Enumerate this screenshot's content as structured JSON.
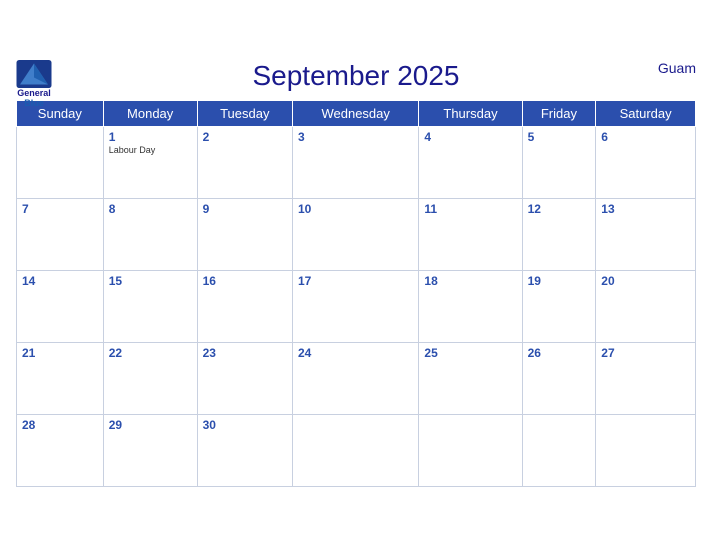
{
  "header": {
    "logo": {
      "general": "General",
      "blue": "Blue"
    },
    "title": "September 2025",
    "region": "Guam"
  },
  "days_of_week": [
    "Sunday",
    "Monday",
    "Tuesday",
    "Wednesday",
    "Thursday",
    "Friday",
    "Saturday"
  ],
  "weeks": [
    [
      {
        "date": "",
        "holiday": ""
      },
      {
        "date": "1",
        "holiday": "Labour Day"
      },
      {
        "date": "2",
        "holiday": ""
      },
      {
        "date": "3",
        "holiday": ""
      },
      {
        "date": "4",
        "holiday": ""
      },
      {
        "date": "5",
        "holiday": ""
      },
      {
        "date": "6",
        "holiday": ""
      }
    ],
    [
      {
        "date": "7",
        "holiday": ""
      },
      {
        "date": "8",
        "holiday": ""
      },
      {
        "date": "9",
        "holiday": ""
      },
      {
        "date": "10",
        "holiday": ""
      },
      {
        "date": "11",
        "holiday": ""
      },
      {
        "date": "12",
        "holiday": ""
      },
      {
        "date": "13",
        "holiday": ""
      }
    ],
    [
      {
        "date": "14",
        "holiday": ""
      },
      {
        "date": "15",
        "holiday": ""
      },
      {
        "date": "16",
        "holiday": ""
      },
      {
        "date": "17",
        "holiday": ""
      },
      {
        "date": "18",
        "holiday": ""
      },
      {
        "date": "19",
        "holiday": ""
      },
      {
        "date": "20",
        "holiday": ""
      }
    ],
    [
      {
        "date": "21",
        "holiday": ""
      },
      {
        "date": "22",
        "holiday": ""
      },
      {
        "date": "23",
        "holiday": ""
      },
      {
        "date": "24",
        "holiday": ""
      },
      {
        "date": "25",
        "holiday": ""
      },
      {
        "date": "26",
        "holiday": ""
      },
      {
        "date": "27",
        "holiday": ""
      }
    ],
    [
      {
        "date": "28",
        "holiday": ""
      },
      {
        "date": "29",
        "holiday": ""
      },
      {
        "date": "30",
        "holiday": ""
      },
      {
        "date": "",
        "holiday": ""
      },
      {
        "date": "",
        "holiday": ""
      },
      {
        "date": "",
        "holiday": ""
      },
      {
        "date": "",
        "holiday": ""
      }
    ]
  ]
}
